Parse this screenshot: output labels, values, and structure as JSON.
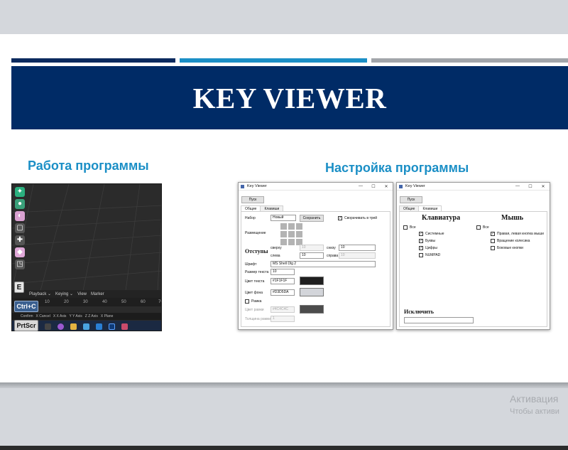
{
  "slide": {
    "title": "KEY VIEWER",
    "left_heading": "Работа программы",
    "right_heading": "Настройка программы"
  },
  "blender": {
    "menu": [
      "Playback ⌄",
      "Keying ⌄",
      "View",
      "Marker"
    ],
    "ruler": [
      "10",
      "20",
      "30",
      "40",
      "50",
      "60",
      "70"
    ],
    "status": [
      "Confirm",
      "X Cancel",
      "X X Axis",
      "Y Y Axis",
      "Z Z Axis",
      "X Plane"
    ],
    "keys": {
      "k1": "E",
      "k2": "Ctrl+C",
      "k3": "PrtScr"
    }
  },
  "win1": {
    "title": "Key Viewer",
    "start": "Пуск",
    "tabs": [
      "Общие",
      "Клавиши"
    ],
    "set_label": "Набор",
    "set_value": "Новый",
    "save": "Сохранить",
    "tray": "Сворачивать в трей",
    "placement": "Размещение",
    "margins": "Отступы",
    "top": "сверху",
    "top_val": "10",
    "bottom": "снизу",
    "bottom_val": "10",
    "left": "слева",
    "left_val": "10",
    "right": "справа",
    "right_val": "10",
    "font_label": "Шрифт",
    "font_value": "MS Shell Dlg 2",
    "size_label": "Размер текста",
    "size_value": "10",
    "text_color_label": "Цвет текста",
    "text_color": "#1F1F1F",
    "bg_color_label": "Цвет фона",
    "bg_color": "#D3D5DA",
    "frame": "Рамка",
    "frame_color_label": "Цвет рамки",
    "frame_color": "#4C4C4C",
    "frame_width_label": "Толщина рамки",
    "frame_width": "1"
  },
  "win2": {
    "title": "Key Viewer",
    "start": "Пуск",
    "tabs": [
      "Общие",
      "Клавиши"
    ],
    "kb_head": "Клавиатура",
    "mouse_head": "Мышь",
    "all": "Все",
    "kb_items": [
      "Системные",
      "Буквы",
      "Цифры",
      "NUMPAD"
    ],
    "mouse_items": [
      "Правая, левая кнопка мыши",
      "Вращение колесика",
      "Боковые кнопки"
    ],
    "exclude": "Исключить"
  },
  "watermark": {
    "line1": "Активация",
    "line2": "Чтобы активи"
  },
  "colors": {
    "banner": "#002b66",
    "accent": "#1b8fc6",
    "stripe_dark": "#0b2a5e",
    "stripe_gray": "#a2a5aa"
  }
}
